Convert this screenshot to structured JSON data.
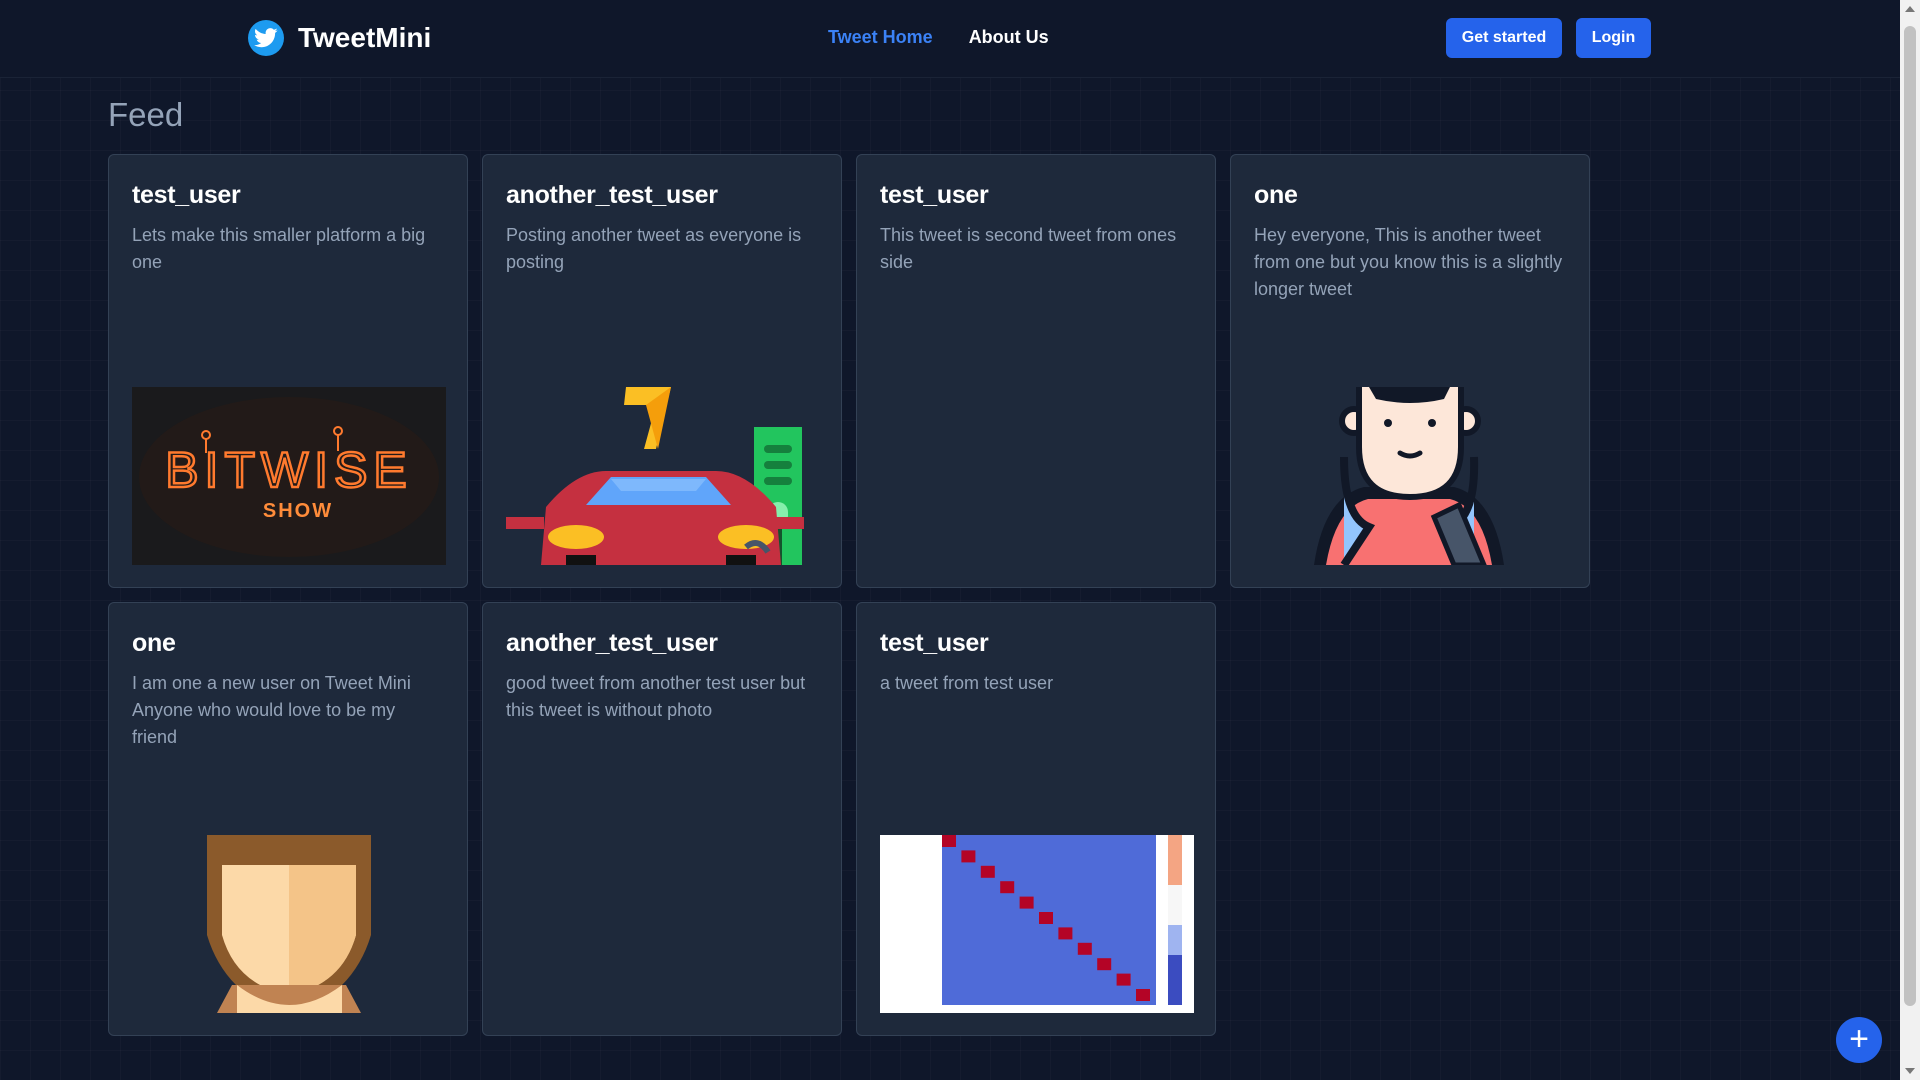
{
  "brand": {
    "name": "TweetMini",
    "icon": "twitter-bird-icon",
    "color": "#1d9bf0"
  },
  "nav": {
    "links": [
      {
        "label": "Tweet Home",
        "active": true
      },
      {
        "label": "About Us",
        "active": false
      }
    ],
    "get_started_label": "Get started",
    "login_label": "Login"
  },
  "feed": {
    "title": "Feed",
    "tweets": [
      {
        "user": "test_user",
        "text": "Lets make this smaller platform a big one",
        "media": "bitwise-show-neon-logo"
      },
      {
        "user": "another_test_user",
        "text": "Posting another tweet as everyone is posting",
        "media": "car-charging-illustration"
      },
      {
        "user": "test_user",
        "text": "This tweet is second tweet from ones side",
        "media": null
      },
      {
        "user": "one",
        "text": "Hey everyone, This is another tweet from one but you know this is a slightly longer tweet",
        "media": "driver-avatar-illustration"
      },
      {
        "user": "one",
        "text": "I am one a new user on Tweet Mini Anyone who would love to be my friend",
        "media": "face-avatar-illustration"
      },
      {
        "user": "another_test_user",
        "text": "good tweet from another test user but this tweet is without photo",
        "media": null
      },
      {
        "user": "test_user",
        "text": "a tweet from test user",
        "media": "correlation-heatmap-image"
      }
    ]
  },
  "fab": {
    "label": "+",
    "icon": "plus-icon"
  },
  "colors": {
    "accent": "#2563eb",
    "background": "#0f172a",
    "card": "#1e293b"
  }
}
